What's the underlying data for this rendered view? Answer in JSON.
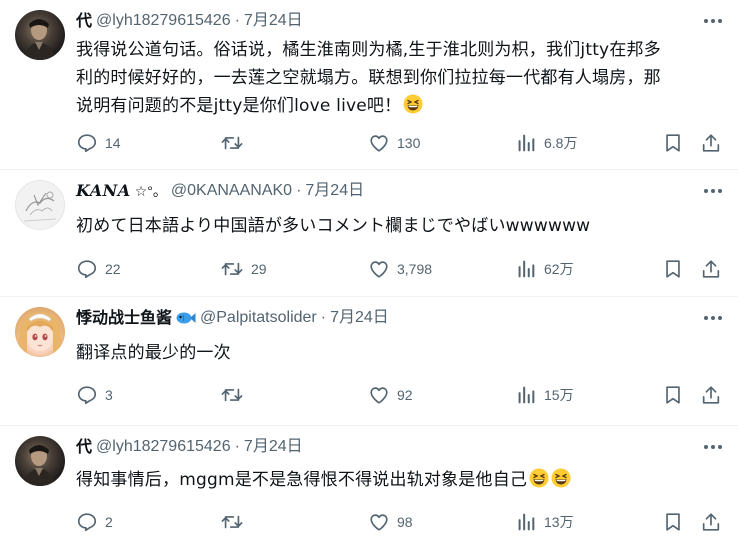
{
  "tweets": [
    {
      "display_name": "代",
      "handle": "@lyh18279615426",
      "date": "7月24日",
      "avatar": "dark-photo-avatar",
      "lines": [
        "我得说公道句话。俗话说，橘生淮南则为橘,生于淮北则为枳，我们jtty在邦多",
        "利的时候好好的，一去莲之空就塌方。联想到你们拉拉每一代都有人塌房，那",
        "说明有问题的不是jtty是你们love live吧！"
      ],
      "emoji_count": 1,
      "stats": {
        "replies": "14",
        "retweets": "",
        "likes": "130",
        "views": "6.8万"
      }
    },
    {
      "display_name": "KANA",
      "name_suffix": "☆°。",
      "handle": "@0KANAANAK0",
      "date": "7月24日",
      "avatar": "sketch-avatar",
      "lines": [
        "初めて日本語より中国語が多いコメント欄まじでやばいwwwwww"
      ],
      "emoji_count": 0,
      "stats": {
        "replies": "22",
        "retweets": "29",
        "likes": "3,798",
        "views": "62万"
      }
    },
    {
      "display_name": "悸动战士鱼酱",
      "handle": "@Palpitatsolider",
      "date": "7月24日",
      "avatar": "anime-avatar",
      "name_icon": "fish-icon",
      "lines": [
        "翻译点的最少的一次"
      ],
      "emoji_count": 0,
      "stats": {
        "replies": "3",
        "retweets": "",
        "likes": "92",
        "views": "15万"
      }
    },
    {
      "display_name": "代",
      "handle": "@lyh18279615426",
      "date": "7月24日",
      "avatar": "dark-photo-avatar",
      "lines": [
        "得知事情后，mggm是不是急得恨不得说出轨对象是他自己"
      ],
      "emoji_count": 2,
      "stats": {
        "replies": "2",
        "retweets": "",
        "likes": "98",
        "views": "13万"
      }
    }
  ],
  "separator": "·",
  "icons": {
    "reply": "reply-icon",
    "retweet": "retweet-icon",
    "like": "heart-icon",
    "views": "views-chart-icon",
    "bookmark": "bookmark-icon",
    "share": "share-icon",
    "more": "more-options-icon",
    "emoji": "grinning-squinting-face-emoji"
  },
  "colors": {
    "text": "#0f1419",
    "secondary": "#536471",
    "divider": "#eff3f4",
    "emoji": "#ffcc33"
  }
}
